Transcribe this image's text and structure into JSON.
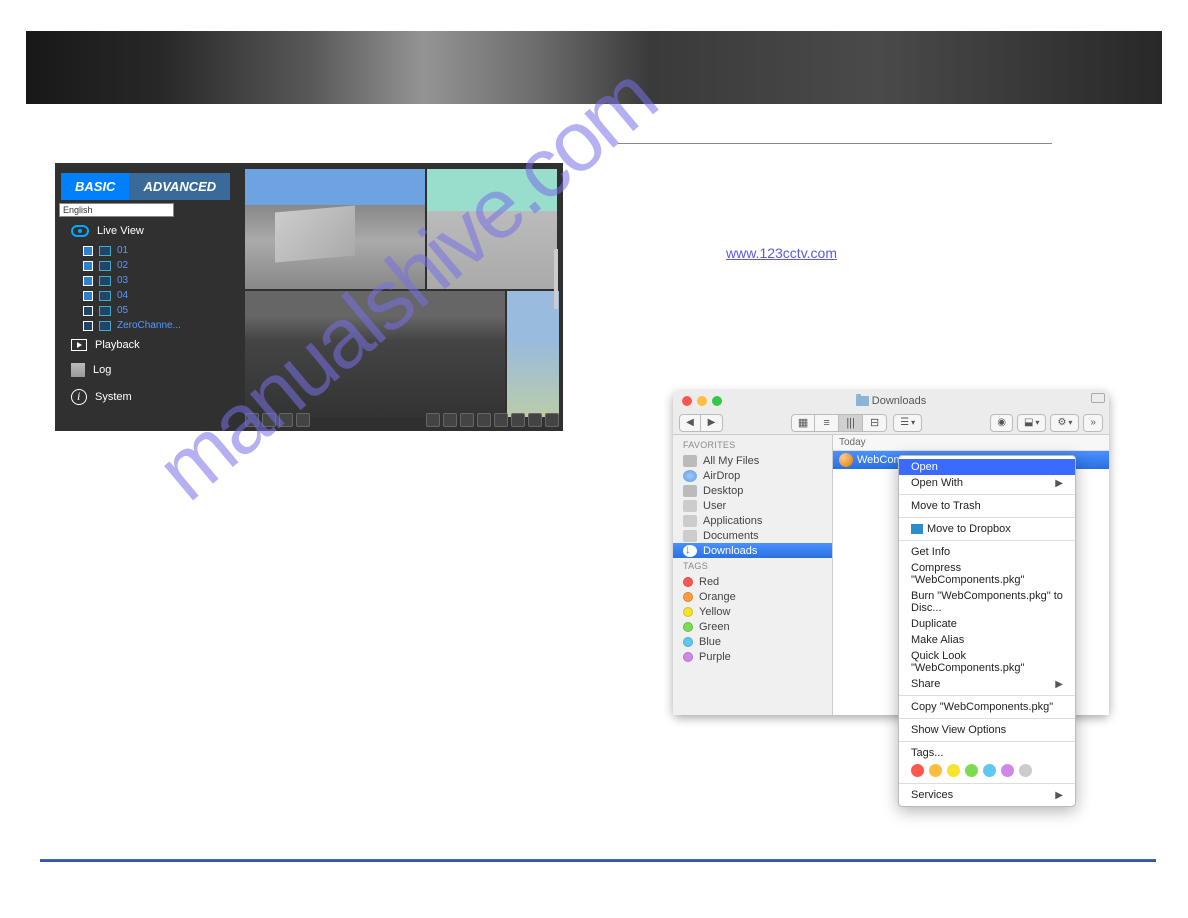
{
  "nvr": {
    "tab_basic": "BASIC",
    "tab_advanced": "ADVANCED",
    "language": "English",
    "live_view": "Live View",
    "channels": {
      "c1": "01",
      "c2": "02",
      "c3": "03",
      "c4": "04",
      "c5": "05",
      "zero": "ZeroChanne..."
    },
    "playback": "Playback",
    "log": "Log",
    "system": "System"
  },
  "download": {
    "link_text": "www.123cctv.com"
  },
  "finder": {
    "title": "Downloads",
    "nav": {
      "back": "◀",
      "fwd": "▶"
    },
    "sidebar": {
      "favorites_heading": "FAVORITES",
      "all_my_files": "All My Files",
      "airdrop": "AirDrop",
      "desktop": "Desktop",
      "user": "User",
      "applications": "Applications",
      "documents": "Documents",
      "downloads": "Downloads",
      "tags_heading": "TAGS",
      "red": "Red",
      "orange": "Orange",
      "yellow": "Yellow",
      "green": "Green",
      "blue": "Blue",
      "purple": "Purple"
    },
    "column_header": "Today",
    "file_name": "WebCompon",
    "context_menu": {
      "open": "Open",
      "open_with": "Open With",
      "move_to_trash": "Move to Trash",
      "move_to_dropbox": "Move to Dropbox",
      "get_info": "Get Info",
      "compress": "Compress \"WebComponents.pkg\"",
      "burn": "Burn \"WebComponents.pkg\" to Disc...",
      "duplicate": "Duplicate",
      "make_alias": "Make Alias",
      "quick_look": "Quick Look \"WebComponents.pkg\"",
      "share": "Share",
      "copy": "Copy \"WebComponents.pkg\"",
      "show_view_options": "Show View Options",
      "tags": "Tags...",
      "services": "Services"
    },
    "tag_colors": [
      "#fc5852",
      "#fdbd3f",
      "#f8e22b",
      "#7cdb4e",
      "#5fc8f0",
      "#d187e8",
      "#cccccc"
    ]
  }
}
